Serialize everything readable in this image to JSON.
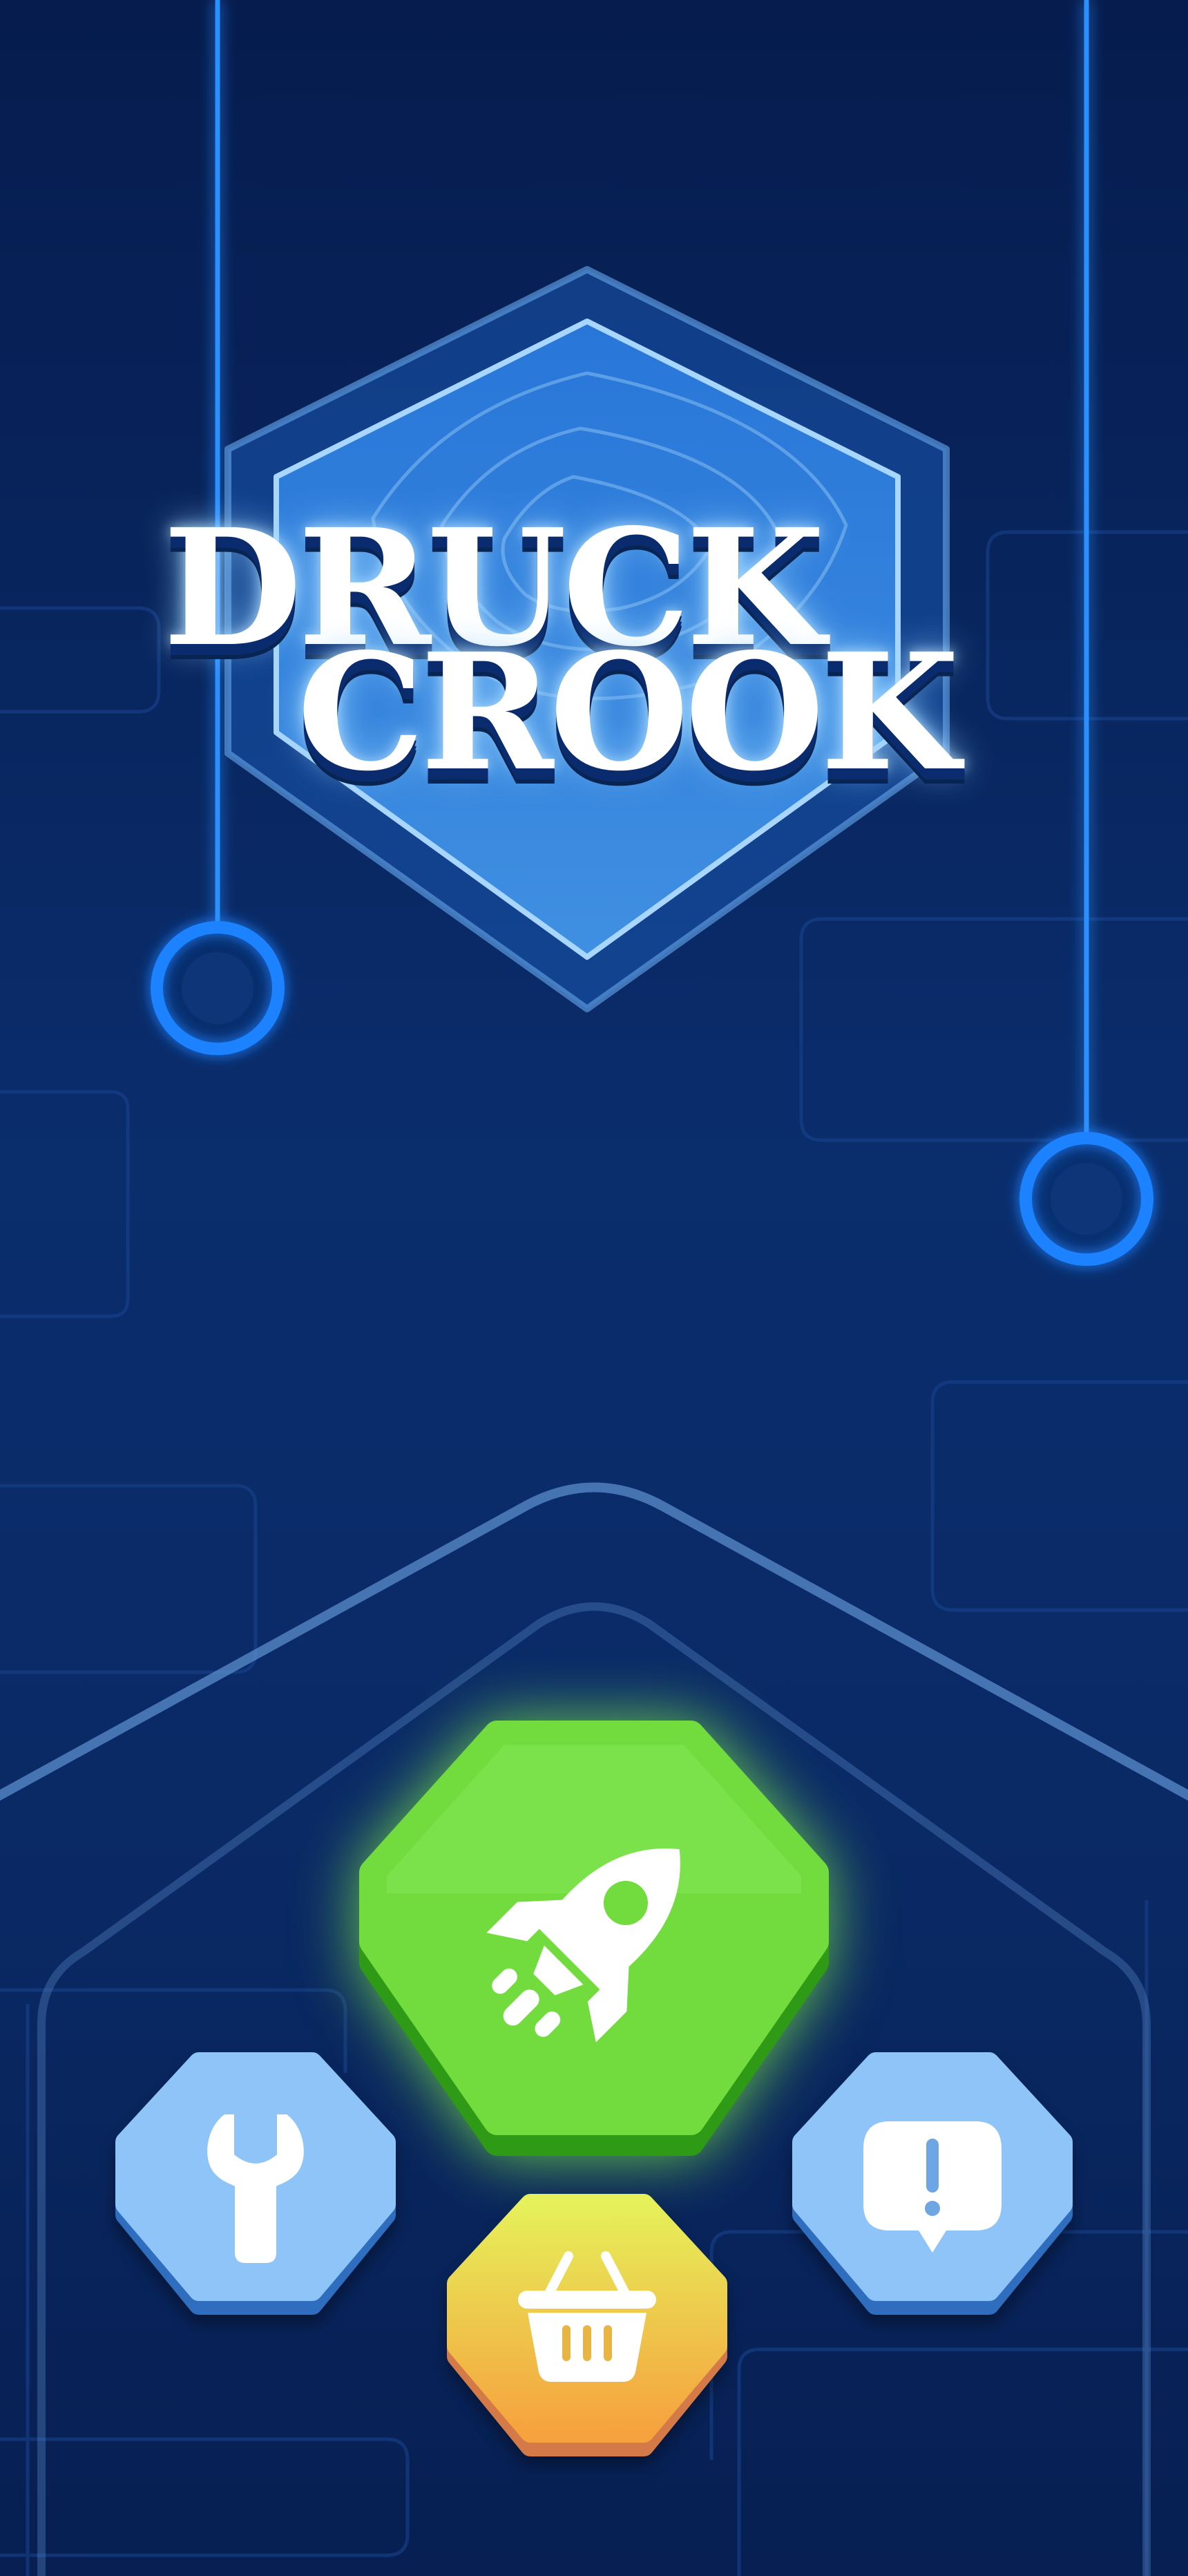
{
  "title": {
    "line1": "DRUCK",
    "line2": "CROOK"
  },
  "buttons": {
    "play": {
      "icon": "rocket-icon",
      "color": "#6fd93a"
    },
    "settings": {
      "icon": "wrench-icon",
      "color": "#8cc2f7"
    },
    "shop": {
      "icon": "basket-icon",
      "color": "#f5c24a"
    },
    "alert": {
      "icon": "exclamation-bubble-icon",
      "color": "#8cc2f7"
    }
  },
  "colors": {
    "background": "#0a2d6c",
    "neon": "#2a8fff",
    "title_fill": "#ffffff"
  }
}
